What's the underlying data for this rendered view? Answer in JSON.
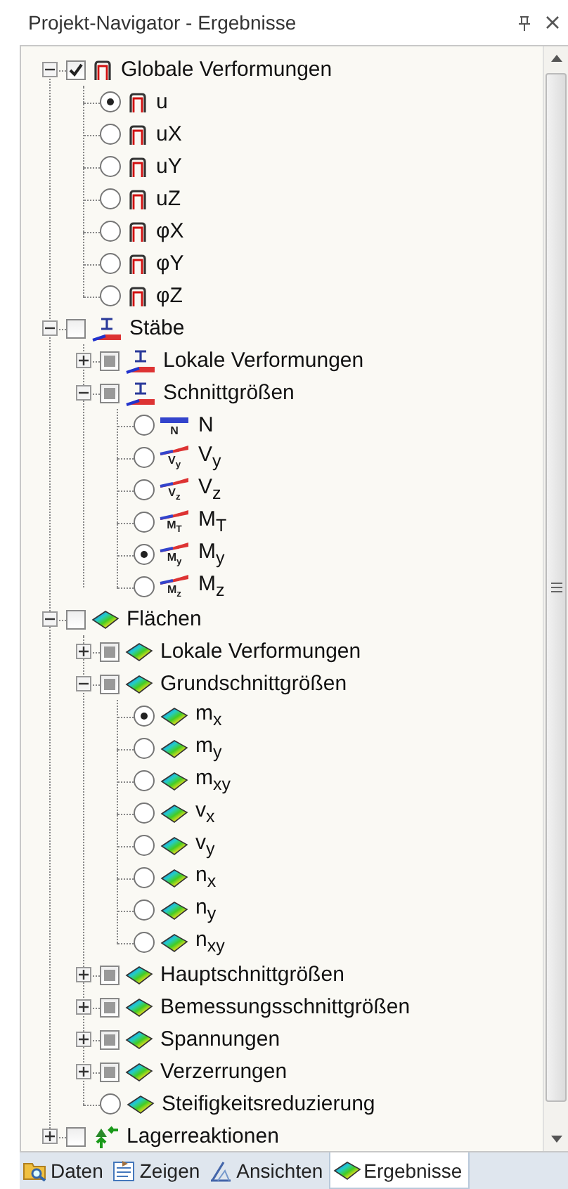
{
  "panel": {
    "title": "Projekt-Navigator - Ergebnisse"
  },
  "tree": [
    {
      "kind": "checkbox",
      "checked": true,
      "partial": false,
      "label": "Globale Verformungen",
      "expanded": true,
      "children": [
        {
          "kind": "radio",
          "selected": true,
          "label": "u"
        },
        {
          "kind": "radio",
          "selected": false,
          "label": "uX"
        },
        {
          "kind": "radio",
          "selected": false,
          "label": "uY"
        },
        {
          "kind": "radio",
          "selected": false,
          "label": "uZ"
        },
        {
          "kind": "radio",
          "selected": false,
          "label": "φX"
        },
        {
          "kind": "radio",
          "selected": false,
          "label": "φY"
        },
        {
          "kind": "radio",
          "selected": false,
          "label": "φZ"
        }
      ]
    },
    {
      "kind": "checkbox",
      "checked": false,
      "partial": false,
      "label": "Stäbe",
      "expanded": true,
      "children": [
        {
          "kind": "checkbox",
          "checked": false,
          "partial": true,
          "label": "Lokale Verformungen",
          "expanded": false
        },
        {
          "kind": "checkbox",
          "checked": false,
          "partial": true,
          "label": "Schnittgrößen",
          "expanded": true,
          "children": [
            {
              "kind": "radio",
              "selected": false,
              "icon_text": "N",
              "label": "N"
            },
            {
              "kind": "radio",
              "selected": false,
              "icon_text": "V$_{y}$",
              "label": "V$_{y}$"
            },
            {
              "kind": "radio",
              "selected": false,
              "icon_text": "V$_{z}$",
              "label": "V$_{z}$"
            },
            {
              "kind": "radio",
              "selected": false,
              "icon_text": "M$_{T}$",
              "label": "M$_{T}$"
            },
            {
              "kind": "radio",
              "selected": true,
              "icon_text": "M$_{y}$",
              "label": "M$_{y}$"
            },
            {
              "kind": "radio",
              "selected": false,
              "icon_text": "M$_{z}$",
              "label": "M$_{z}$"
            }
          ]
        }
      ]
    },
    {
      "kind": "checkbox",
      "checked": false,
      "partial": false,
      "label": "Flächen",
      "expanded": true,
      "children": [
        {
          "kind": "checkbox",
          "checked": false,
          "partial": true,
          "label": "Lokale Verformungen",
          "expanded": false
        },
        {
          "kind": "checkbox",
          "checked": false,
          "partial": true,
          "label": "Grundschnittgrößen",
          "expanded": true,
          "children": [
            {
              "kind": "radio",
              "selected": true,
              "label": "m$_{x}$"
            },
            {
              "kind": "radio",
              "selected": false,
              "label": "m$_{y}$"
            },
            {
              "kind": "radio",
              "selected": false,
              "label": "m$_{xy}$"
            },
            {
              "kind": "radio",
              "selected": false,
              "label": "v$_{x}$"
            },
            {
              "kind": "radio",
              "selected": false,
              "label": "v$_{y}$"
            },
            {
              "kind": "radio",
              "selected": false,
              "label": "n$_{x}$"
            },
            {
              "kind": "radio",
              "selected": false,
              "label": "n$_{y}$"
            },
            {
              "kind": "radio",
              "selected": false,
              "label": "n$_{xy}$"
            }
          ]
        },
        {
          "kind": "checkbox",
          "checked": false,
          "partial": true,
          "label": "Hauptschnittgrößen",
          "expanded": false
        },
        {
          "kind": "checkbox",
          "checked": false,
          "partial": true,
          "label": "Bemessungsschnittgrößen",
          "expanded": false
        },
        {
          "kind": "checkbox",
          "checked": false,
          "partial": true,
          "label": "Spannungen",
          "expanded": false
        },
        {
          "kind": "checkbox",
          "checked": false,
          "partial": true,
          "label": "Verzerrungen",
          "expanded": false
        },
        {
          "kind": "radio",
          "selected": false,
          "label": "Steifigkeitsreduzierung"
        }
      ]
    },
    {
      "kind": "checkbox",
      "checked": false,
      "partial": false,
      "label": "Lagerreaktionen",
      "expanded": false
    }
  ],
  "tabs": [
    {
      "label": "Daten",
      "selected": false
    },
    {
      "label": "Zeigen",
      "selected": false
    },
    {
      "label": "Ansichten",
      "selected": false
    },
    {
      "label": "Ergebnisse",
      "selected": true
    }
  ]
}
